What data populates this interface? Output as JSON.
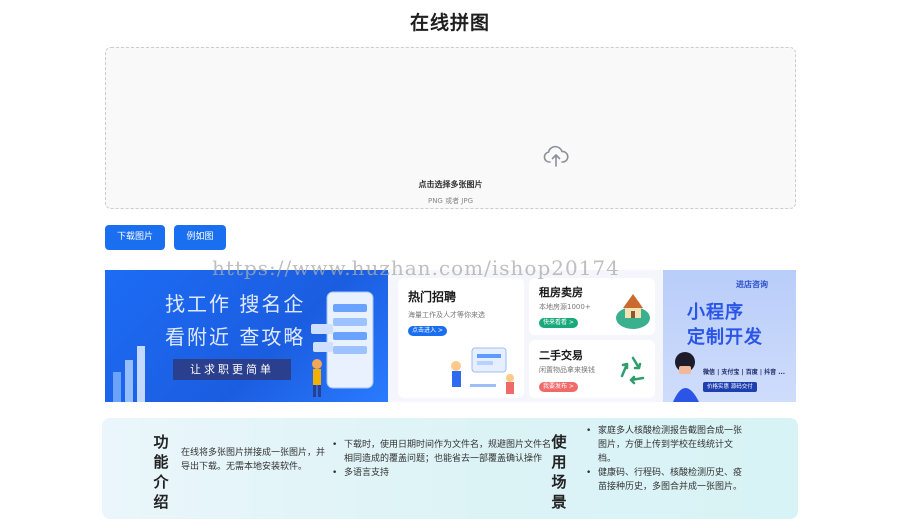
{
  "page": {
    "title": "在线拼图"
  },
  "upload": {
    "main_hint": "点击选择多张图片",
    "sub_hint": "PNG 或者 JPG",
    "icon": "cloud-upload-icon"
  },
  "actions": {
    "download_label": "下载图片",
    "example_label": "例如图"
  },
  "watermark": "https://www.huzhan.com/ishop20174",
  "ads": {
    "jobs": {
      "line1": "找工作  搜名企",
      "line2": "看附近  查攻略",
      "slogan": "让求职更简单"
    },
    "middle": {
      "hot_title": "热门招聘",
      "hot_sub": "海量工作及人才等你来选",
      "hot_pill": "点击进入 >",
      "rent_title": "租房卖房",
      "rent_sub": "本地房源1000+",
      "rent_pill": "快来看看 >",
      "used_title": "二手交易",
      "used_sub": "闲置物品拿来换钱",
      "used_pill": "我要发布 >"
    },
    "mini": {
      "tag": "进店咨询",
      "line1": "小程序",
      "line2": "定制开发",
      "platforms": "微信 | 支付宝 | 百度 | 抖音 ...",
      "foot": "价格实惠  源码交付"
    }
  },
  "info": {
    "feature_heading": "功能介绍",
    "feature_intro": "在线将多张图片拼接成一张图片，并导出下载。无需本地安装软件。",
    "features": [
      "下载时，使用日期时间作为文件名，规避图片文件名相同造成的覆盖问题；也能省去一部覆盖确认操作",
      "多语言支持"
    ],
    "scenario_heading": "使用场景",
    "scenarios": [
      "家庭多人核酸检测报告截图合成一张图片，方便上传到学校在线统计文档。",
      "健康码、行程码、核酸检测历史、疫苗接种历史，多图合并成一张图片。"
    ]
  },
  "colors": {
    "accent": "#1a6ff0",
    "jobs_bg": "#1d6cf5",
    "info_bg": "#dcf3f6"
  }
}
